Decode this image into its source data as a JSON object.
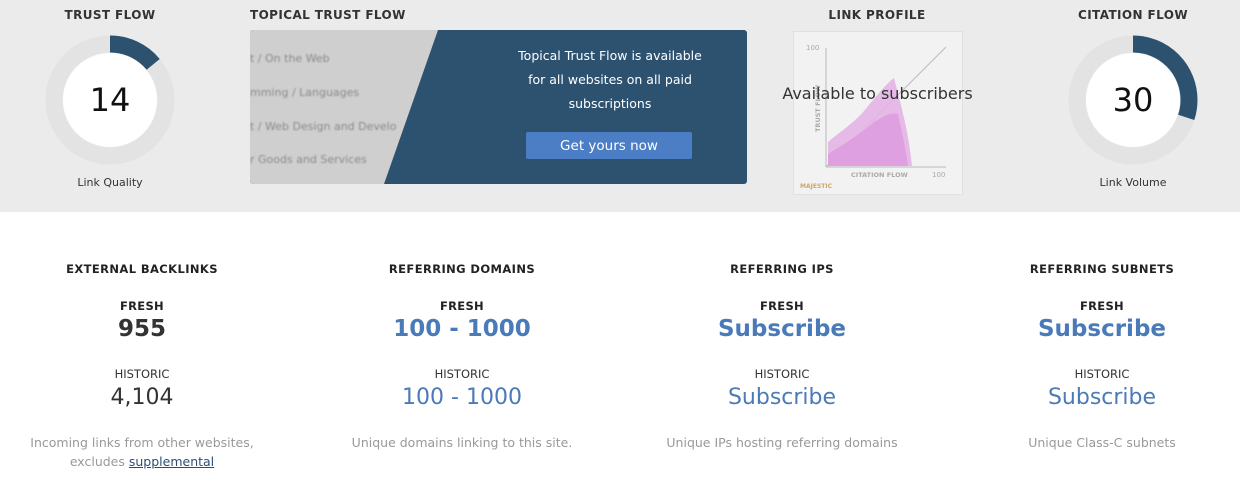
{
  "trust_flow": {
    "title": "TRUST FLOW",
    "value": "14",
    "caption": "Link Quality",
    "fraction": 0.14
  },
  "topical_trust_flow": {
    "title": "TOPICAL TRUST FLOW",
    "blurred_items": [
      "t / On the Web",
      "mming / Languages",
      "t / Web Design and Develo",
      "r Goods and Services"
    ],
    "message_lines": [
      "Topical Trust Flow is available",
      "for all websites on all paid",
      "subscriptions"
    ],
    "cta": "Get yours now"
  },
  "link_profile": {
    "title": "LINK PROFILE",
    "overlay": "Available to subscribers",
    "y_tick": "100",
    "x_tick": "100",
    "ylabel": "TRUST FLOW",
    "xlabel": "CITATION FLOW",
    "brand": "MAJESTIC"
  },
  "citation_flow": {
    "title": "CITATION FLOW",
    "value": "30",
    "caption": "Link Volume",
    "fraction": 0.3
  },
  "stats": [
    {
      "title": "EXTERNAL BACKLINKS",
      "fresh_label": "FRESH",
      "fresh_value": "955",
      "historic_label": "HISTORIC",
      "historic_value": "4,104",
      "desc_line1": "Incoming links from other websites,",
      "desc_line2_prefix": "excludes ",
      "desc_link": "supplemental"
    },
    {
      "title": "REFERRING DOMAINS",
      "fresh_label": "FRESH",
      "fresh_value": "100 - 1000",
      "historic_label": "HISTORIC",
      "historic_value": "100 - 1000",
      "desc_line1": "Unique domains linking to this site."
    },
    {
      "title": "REFERRING IPS",
      "fresh_label": "FRESH",
      "fresh_value": "Subscribe",
      "historic_label": "HISTORIC",
      "historic_value": "Subscribe",
      "desc_line1": "Unique IPs hosting referring domains"
    },
    {
      "title": "REFERRING SUBNETS",
      "fresh_label": "FRESH",
      "fresh_value": "Subscribe",
      "historic_label": "HISTORIC",
      "historic_value": "Subscribe",
      "desc_line1": "Unique Class-C subnets"
    }
  ],
  "colors": {
    "gauge_fill": "#2d5270",
    "gauge_track": "#e3e3e3",
    "accent": "#4a7ab8",
    "card": "#2d5270",
    "button": "#4b7ec4"
  }
}
